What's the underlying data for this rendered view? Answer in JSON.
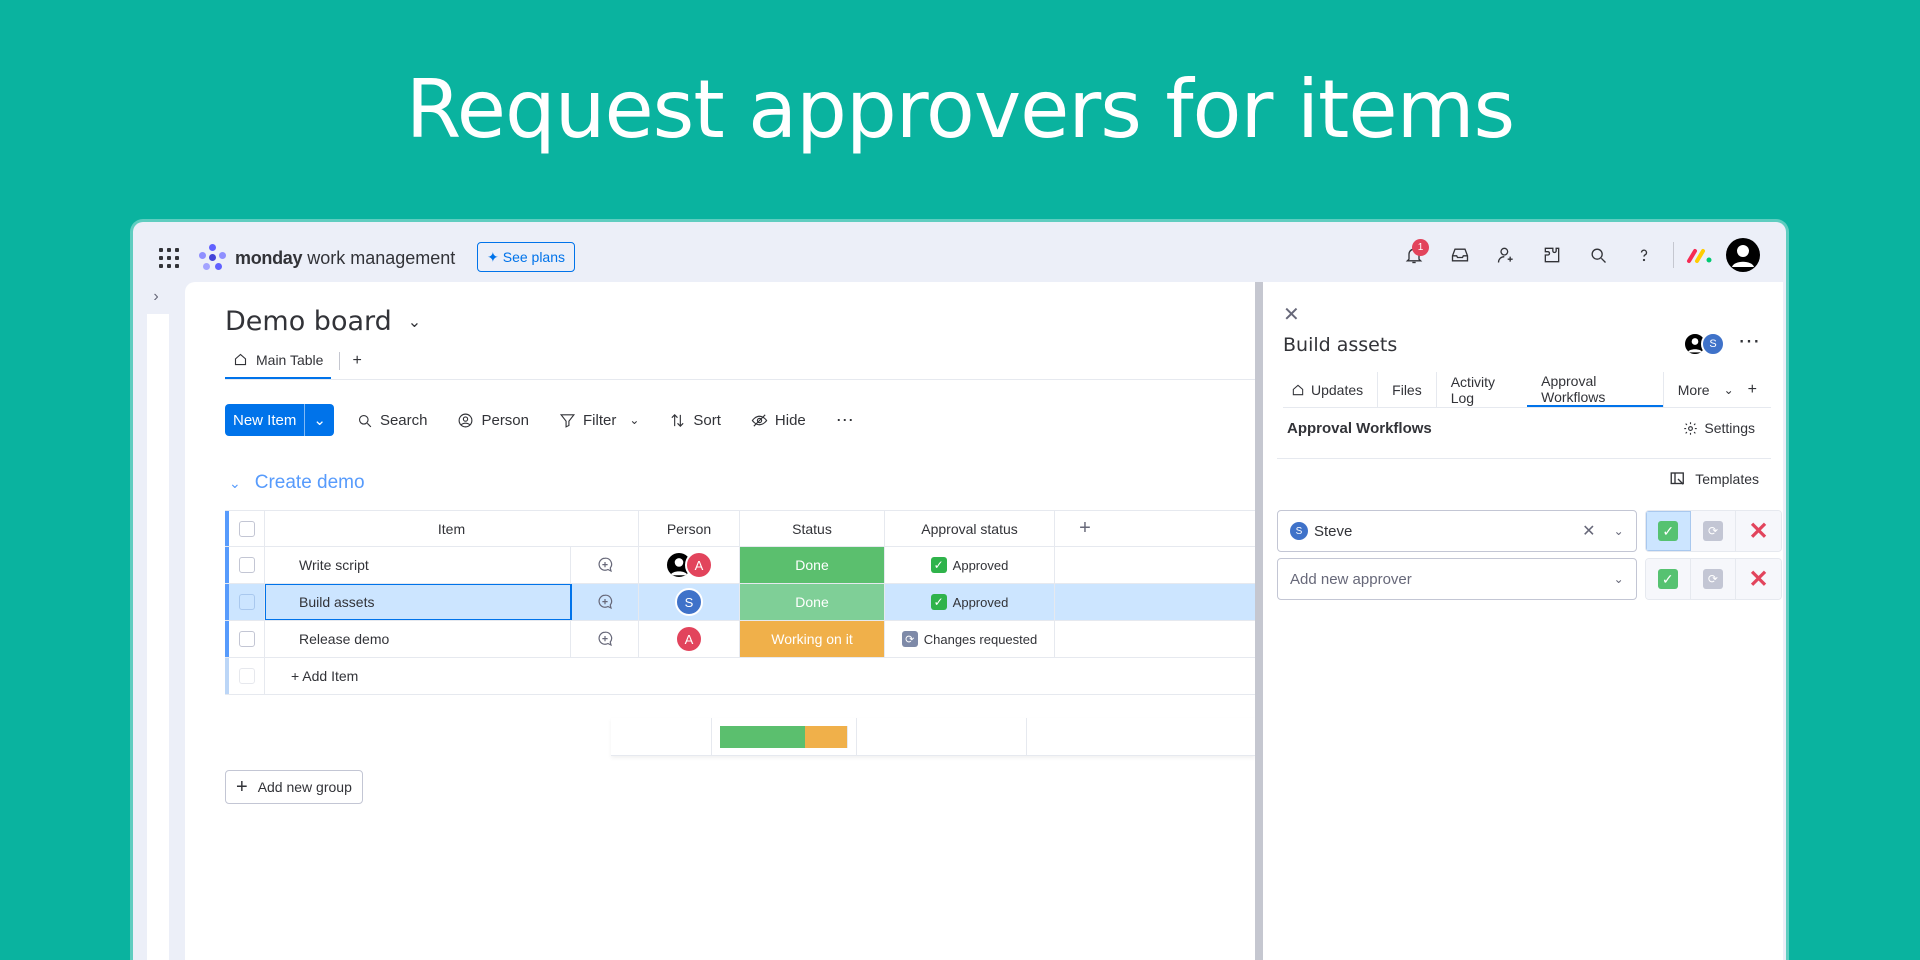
{
  "hero": {
    "title": "Request approvers for items"
  },
  "topbar": {
    "brand_bold": "monday",
    "brand_rest": "work management",
    "see_plans": "See plans",
    "notifications_count": "1",
    "icons": [
      "apps-grid-icon",
      "bell-icon",
      "inbox-icon",
      "invite-icon",
      "integrations-icon",
      "search-icon",
      "help-icon",
      "monday-logo-icon",
      "avatar"
    ]
  },
  "board": {
    "title": "Demo board",
    "tabs": [
      {
        "label": "Main Table"
      }
    ],
    "toolbar": {
      "new_item": "New Item",
      "search": "Search",
      "person": "Person",
      "filter": "Filter",
      "sort": "Sort",
      "hide": "Hide"
    },
    "group": {
      "title": "Create demo",
      "color": "#579bfc"
    },
    "columns": {
      "item": "Item",
      "person": "Person",
      "status": "Status",
      "approval": "Approval status"
    },
    "rows": [
      {
        "item": "Write script",
        "persons": [
          "",
          "A"
        ],
        "status": "Done",
        "status_color": "#5bbf6e",
        "approval": "Approved"
      },
      {
        "item": "Build assets",
        "persons": [
          "S"
        ],
        "status": "Done",
        "status_color": "#7fcf97",
        "approval": "Approved"
      },
      {
        "item": "Release demo",
        "persons": [
          "A"
        ],
        "status": "Working on it",
        "status_color": "#f0b04a",
        "approval": "Changes requested"
      }
    ],
    "add_item": "+ Add Item",
    "status_summary": {
      "done_fraction": 0.67,
      "working_fraction": 0.33
    },
    "add_group": "Add new group"
  },
  "panel": {
    "item_title": "Build assets",
    "tabs": [
      "Updates",
      "Files",
      "Activity Log",
      "Approval Workflows",
      "More"
    ],
    "active_tab": "Approval Workflows",
    "section_title": "Approval Workflows",
    "settings": "Settings",
    "templates": "Templates",
    "approvers": [
      {
        "name": "Steve",
        "initial": "S"
      }
    ],
    "add_placeholder": "Add new approver"
  }
}
